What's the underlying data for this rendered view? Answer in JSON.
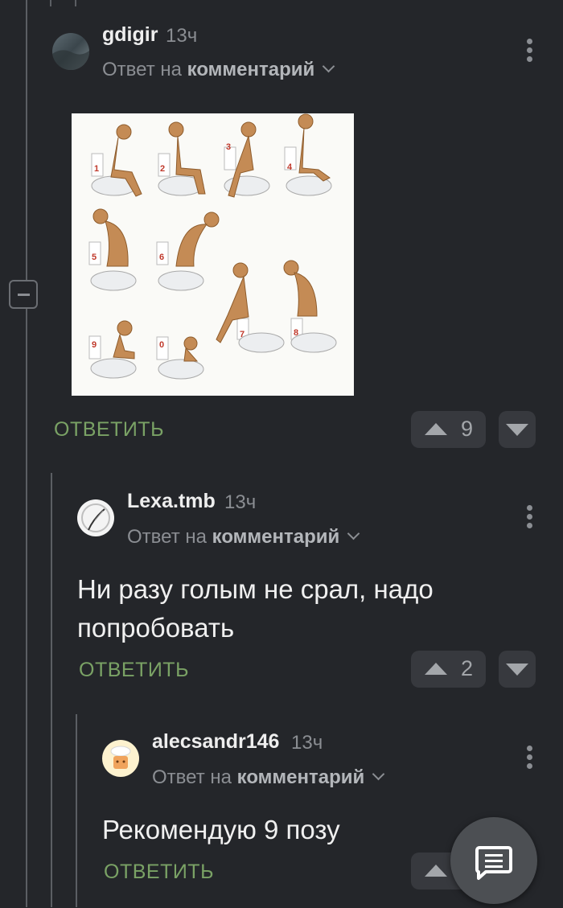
{
  "comments": [
    {
      "username": "gdigir",
      "time": "13ч",
      "reply_prefix": "Ответ на",
      "reply_target": "комментарий",
      "body": "",
      "reply_label": "ОТВЕТИТЬ",
      "votes": "9",
      "image_digits": [
        "1",
        "2",
        "3",
        "4",
        "5",
        "6",
        "7",
        "8",
        "9",
        "0"
      ]
    },
    {
      "username": "Lexa.tmb",
      "time": "13ч",
      "reply_prefix": "Ответ на",
      "reply_target": "комментарий",
      "body_line1": "Ни разу голым не срал, надо",
      "body_line2": "попробовать",
      "reply_label": "ОТВЕТИТЬ",
      "votes": "2"
    },
    {
      "username": "alecsandr146",
      "time": "13ч",
      "reply_prefix": "Ответ на",
      "reply_target": "комментарий",
      "body": "Рекомендую 9 позу",
      "reply_label": "ОТВЕТИТЬ"
    }
  ],
  "icons": {
    "collapse": "minus-icon",
    "menu": "kebab-menu-icon",
    "upvote": "arrow-up-icon",
    "downvote": "arrow-down-icon",
    "fab": "comment-icon"
  },
  "colors": {
    "background": "#24262a",
    "reply_action": "#7aa265",
    "vote_button": "#37393e"
  }
}
